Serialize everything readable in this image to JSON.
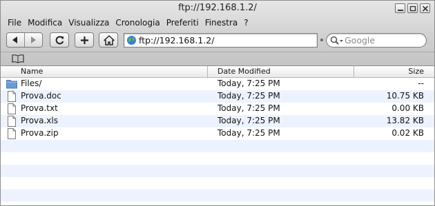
{
  "window": {
    "title": "ftp://192.168.1.2/"
  },
  "menu": {
    "items": [
      "File",
      "Modifica",
      "Visualizza",
      "Cronologia",
      "Preferiti",
      "Finestra",
      "?"
    ]
  },
  "toolbar": {
    "url": "ftp://192.168.1.2/",
    "search_placeholder": "Google"
  },
  "columns": {
    "name": "Name",
    "date": "Date Modified",
    "size": "Size"
  },
  "files": [
    {
      "name": "Files/",
      "date": "Today, 7:25 PM",
      "size": "--",
      "icon": "folder-icon"
    },
    {
      "name": "Prova.doc",
      "date": "Today, 7:25 PM",
      "size": "10.75 KB",
      "icon": "file-icon"
    },
    {
      "name": "Prova.txt",
      "date": "Today, 7:25 PM",
      "size": "0.00 KB",
      "icon": "file-icon"
    },
    {
      "name": "Prova.xls",
      "date": "Today, 7:25 PM",
      "size": "13.82 KB",
      "icon": "file-icon"
    },
    {
      "name": "Prova.zip",
      "date": "Today, 7:25 PM",
      "size": "0.02 KB",
      "icon": "file-icon"
    }
  ],
  "colors": {
    "stripe": "#edf3fe",
    "folder": "#6d9bd1"
  }
}
